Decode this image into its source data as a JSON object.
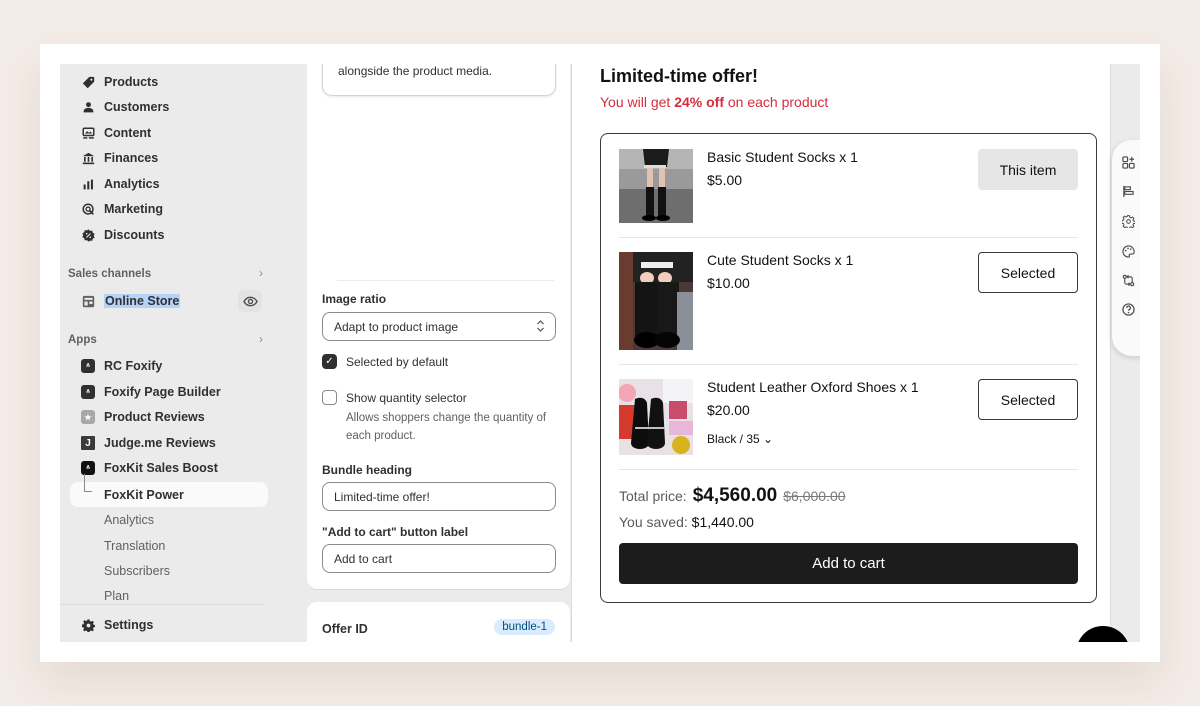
{
  "sidebar": {
    "nav": [
      {
        "label": "Products",
        "icon": "tag-icon"
      },
      {
        "label": "Customers",
        "icon": "person-icon"
      },
      {
        "label": "Content",
        "icon": "content-icon"
      },
      {
        "label": "Finances",
        "icon": "bank-icon"
      },
      {
        "label": "Analytics",
        "icon": "bar-chart-icon"
      },
      {
        "label": "Marketing",
        "icon": "target-icon"
      },
      {
        "label": "Discounts",
        "icon": "discount-icon"
      }
    ],
    "sales_channels": {
      "header": "Sales channels",
      "chevron": "›",
      "items": [
        {
          "label": "Online Store",
          "icon": "store-icon",
          "action_icon": "eye-icon"
        }
      ]
    },
    "apps": {
      "header": "Apps",
      "chevron": "›",
      "items": [
        {
          "label": "RC Foxify",
          "icon": "foxify-icon"
        },
        {
          "label": "Foxify Page Builder",
          "icon": "foxify-icon"
        },
        {
          "label": "Product Reviews",
          "icon": "star-icon"
        },
        {
          "label": "Judge.me Reviews",
          "icon": "judgeme-icon",
          "glyph": "J"
        },
        {
          "label": "FoxKit Sales Boost",
          "icon": "foxkit-icon"
        }
      ],
      "sub_items": [
        {
          "label": "FoxKit Power",
          "active": true
        },
        {
          "label": "Analytics"
        },
        {
          "label": "Translation"
        },
        {
          "label": "Subscribers"
        },
        {
          "label": "Plan"
        }
      ]
    },
    "settings": {
      "label": "Settings",
      "icon": "gear-icon"
    }
  },
  "settings_panel": {
    "description_tail": "alongside the product media.",
    "image_ratio": {
      "label": "Image ratio",
      "value": "Adapt to product image"
    },
    "selected_by_default": {
      "label": "Selected by default",
      "checked": true,
      "glyph": "✓"
    },
    "show_quantity_selector": {
      "label": "Show quantity selector",
      "checked": false,
      "help": "Allows shoppers change the quantity of each product."
    },
    "bundle_heading": {
      "label": "Bundle heading",
      "value": "Limited-time offer!"
    },
    "atc_label": {
      "label": "\"Add to cart\" button label",
      "value": "Add to cart"
    },
    "offer_id": {
      "label": "Offer ID",
      "badge": "bundle-1"
    }
  },
  "preview": {
    "title": "Limited-time offer!",
    "subtitle_prefix": "You will get ",
    "subtitle_discount": "24% off",
    "subtitle_suffix": " on each product",
    "accent_color": "#d72c3a",
    "products": [
      {
        "name": "Basic Student Socks x 1",
        "price": "$5.00",
        "button": "This item"
      },
      {
        "name": "Cute Student Socks x 1",
        "price": "$10.00",
        "button": "Selected"
      },
      {
        "name": "Student Leather Oxford Shoes x 1",
        "price": "$20.00",
        "variant": "Black / 35",
        "variant_icon": "⌄",
        "button": "Selected"
      }
    ],
    "total_label": "Total price:",
    "total_price": "$4,560.00",
    "compare_price": "$6,000.00",
    "saved_label": "You saved:",
    "saved_value": "$1,440.00",
    "add_to_cart": "Add to cart"
  },
  "toolbar": {
    "tools": [
      "add-block-icon",
      "align-icon",
      "settings-icon",
      "palette-icon",
      "sync-icon",
      "help-icon"
    ]
  }
}
